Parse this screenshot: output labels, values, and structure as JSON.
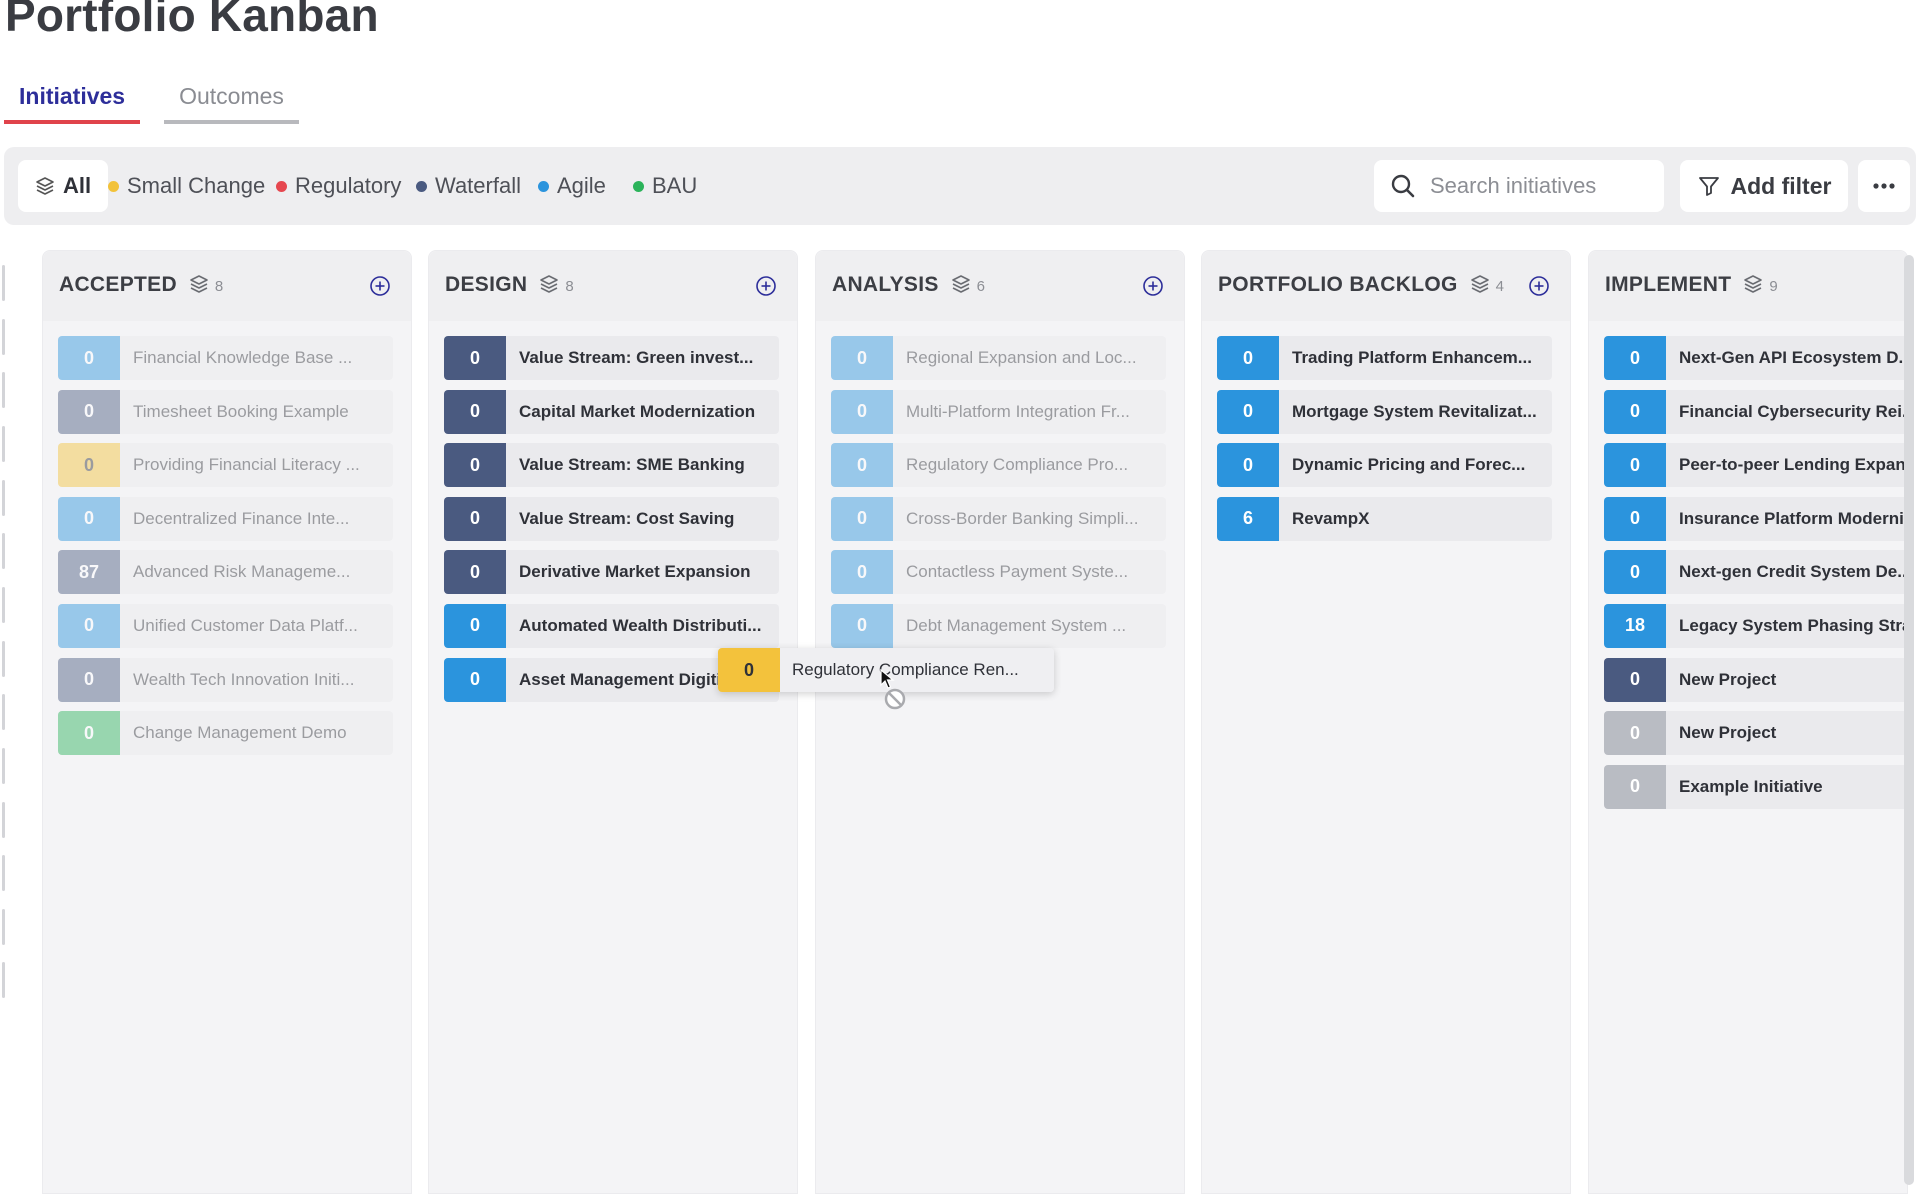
{
  "page": {
    "title": "Portfolio Kanban"
  },
  "tabs": [
    {
      "label": "Initiatives",
      "active": true
    },
    {
      "label": "Outcomes",
      "active": false
    }
  ],
  "filters": {
    "all_label": "All",
    "chips": [
      {
        "label": "Small Change",
        "color": "#f2c23a"
      },
      {
        "label": "Regulatory",
        "color": "#e6474f"
      },
      {
        "label": "Waterfall",
        "color": "#4a5a80"
      },
      {
        "label": "Agile",
        "color": "#2b94dd"
      },
      {
        "label": "BAU",
        "color": "#2bb35a"
      }
    ],
    "search_placeholder": "Search initiatives",
    "add_filter_label": "Add filter"
  },
  "colors": {
    "waterfall": "#4a5a80",
    "agile": "#2b94dd",
    "small_change": "#f2c23a",
    "regulatory": "#e6474f",
    "bau": "#2bb35a",
    "neutral": "#b9bcc3"
  },
  "columns": [
    {
      "title": "ACCEPTED",
      "count": "8",
      "faded": true,
      "cards": [
        {
          "num": "0",
          "title": "Financial Knowledge Base ...",
          "color": "#2b94dd"
        },
        {
          "num": "0",
          "title": "Timesheet Booking Example",
          "color": "#4a5a80"
        },
        {
          "num": "0",
          "title": "Providing Financial Literacy ...",
          "color": "#f2c23a"
        },
        {
          "num": "0",
          "title": "Decentralized Finance Inte...",
          "color": "#2b94dd"
        },
        {
          "num": "87",
          "title": "Advanced Risk Manageme...",
          "color": "#4a5a80"
        },
        {
          "num": "0",
          "title": "Unified Customer Data Platf...",
          "color": "#2b94dd"
        },
        {
          "num": "0",
          "title": "Wealth Tech Innovation Initi...",
          "color": "#4a5a80"
        },
        {
          "num": "0",
          "title": "Change Management Demo",
          "color": "#2bb35a"
        }
      ]
    },
    {
      "title": "DESIGN",
      "count": "8",
      "faded": false,
      "cards": [
        {
          "num": "0",
          "title": "Value Stream: Green invest...",
          "color": "#4a5a80"
        },
        {
          "num": "0",
          "title": "Capital Market Modernization",
          "color": "#4a5a80"
        },
        {
          "num": "0",
          "title": "Value Stream: SME Banking",
          "color": "#4a5a80"
        },
        {
          "num": "0",
          "title": "Value Stream: Cost Saving",
          "color": "#4a5a80"
        },
        {
          "num": "0",
          "title": "Derivative Market Expansion",
          "color": "#4a5a80"
        },
        {
          "num": "0",
          "title": "Automated Wealth Distributi...",
          "color": "#2b94dd"
        },
        {
          "num": "0",
          "title": "Asset Management Digiti",
          "color": "#2b94dd"
        }
      ]
    },
    {
      "title": "ANALYSIS",
      "count": "6",
      "faded": true,
      "cards": [
        {
          "num": "0",
          "title": "Regional Expansion and Loc...",
          "color": "#2b94dd"
        },
        {
          "num": "0",
          "title": "Multi-Platform Integration Fr...",
          "color": "#2b94dd"
        },
        {
          "num": "0",
          "title": "Regulatory Compliance Pro...",
          "color": "#2b94dd"
        },
        {
          "num": "0",
          "title": "Cross-Border Banking Simpli...",
          "color": "#2b94dd"
        },
        {
          "num": "0",
          "title": "Contactless Payment Syste...",
          "color": "#2b94dd"
        },
        {
          "num": "0",
          "title": "Debt Management System ...",
          "color": "#2b94dd"
        }
      ]
    },
    {
      "title": "PORTFOLIO BACKLOG",
      "count": "4",
      "faded": false,
      "cards": [
        {
          "num": "0",
          "title": "Trading Platform Enhancem...",
          "color": "#2b94dd"
        },
        {
          "num": "0",
          "title": "Mortgage System Revitalizat...",
          "color": "#2b94dd"
        },
        {
          "num": "0",
          "title": "Dynamic Pricing and Forec...",
          "color": "#2b94dd"
        },
        {
          "num": "6",
          "title": "RevampX",
          "color": "#2b94dd"
        }
      ]
    },
    {
      "title": "IMPLEMENT",
      "count": "9",
      "faded": false,
      "cards": [
        {
          "num": "0",
          "title": "Next-Gen API Ecosystem D...",
          "color": "#2b94dd"
        },
        {
          "num": "0",
          "title": "Financial Cybersecurity Rei...",
          "color": "#2b94dd"
        },
        {
          "num": "0",
          "title": "Peer-to-peer Lending Expan",
          "color": "#2b94dd"
        },
        {
          "num": "0",
          "title": "Insurance Platform Moderni...",
          "color": "#2b94dd"
        },
        {
          "num": "0",
          "title": "Next-gen Credit System De...",
          "color": "#2b94dd"
        },
        {
          "num": "18",
          "title": "Legacy System Phasing Stra",
          "color": "#2b94dd"
        },
        {
          "num": "0",
          "title": "New Project",
          "color": "#4a5a80"
        },
        {
          "num": "0",
          "title": "New Project",
          "color": "#b9bcc3"
        },
        {
          "num": "0",
          "title": "Example Initiative",
          "color": "#b9bcc3"
        }
      ]
    }
  ],
  "dragging": {
    "num": "0",
    "title": "Regulatory Compliance Ren...",
    "color": "#f2c23a"
  },
  "icons": {
    "layers": "layers-icon",
    "add": "plus-circle-icon",
    "search": "search-icon",
    "filter": "funnel-icon",
    "more": "ellipsis-icon",
    "cursor": "pointer-cursor-icon",
    "not_allowed": "not-allowed-icon"
  }
}
